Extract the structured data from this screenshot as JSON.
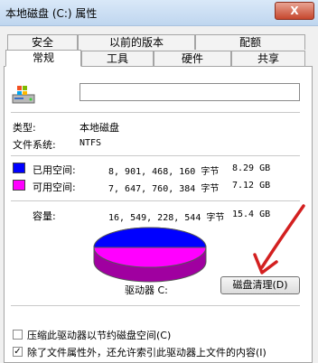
{
  "window": {
    "title": "本地磁盘 (C:) 属性",
    "close_glyph": "X"
  },
  "tabs_row1": [
    "安全",
    "以前的版本",
    "配额"
  ],
  "tabs_row2": [
    "常规",
    "工具",
    "硬件",
    "共享"
  ],
  "active_tab": "常规",
  "general": {
    "name_value": "",
    "type_label": "类型:",
    "type_value": "本地磁盘",
    "fs_label": "文件系统:",
    "fs_value": "NTFS",
    "used_label": "已用空间:",
    "used_bytes": "8, 901, 468, 160 字节",
    "used_size": "8.29 GB",
    "free_label": "可用空间:",
    "free_bytes": "7, 647, 760, 384 字节",
    "free_size": "7.12 GB",
    "capacity_label": "容量:",
    "capacity_bytes": "16, 549, 228, 544 字节",
    "capacity_size": "15.4 GB",
    "drive_label": "驱动器 C:",
    "cleanup_button": "磁盘清理(D)",
    "compress_label": "压缩此驱动器以节约磁盘空间(C)",
    "compress_checked": false,
    "index_label": "除了文件属性外，还允许索引此驱动器上文件的内容(I)",
    "index_checked": true
  },
  "colors": {
    "used": "#0000ff",
    "free": "#ff00ff",
    "annotation_arrow": "#d32020"
  },
  "pie": {
    "used_fraction": 0.538,
    "free_fraction": 0.462
  }
}
